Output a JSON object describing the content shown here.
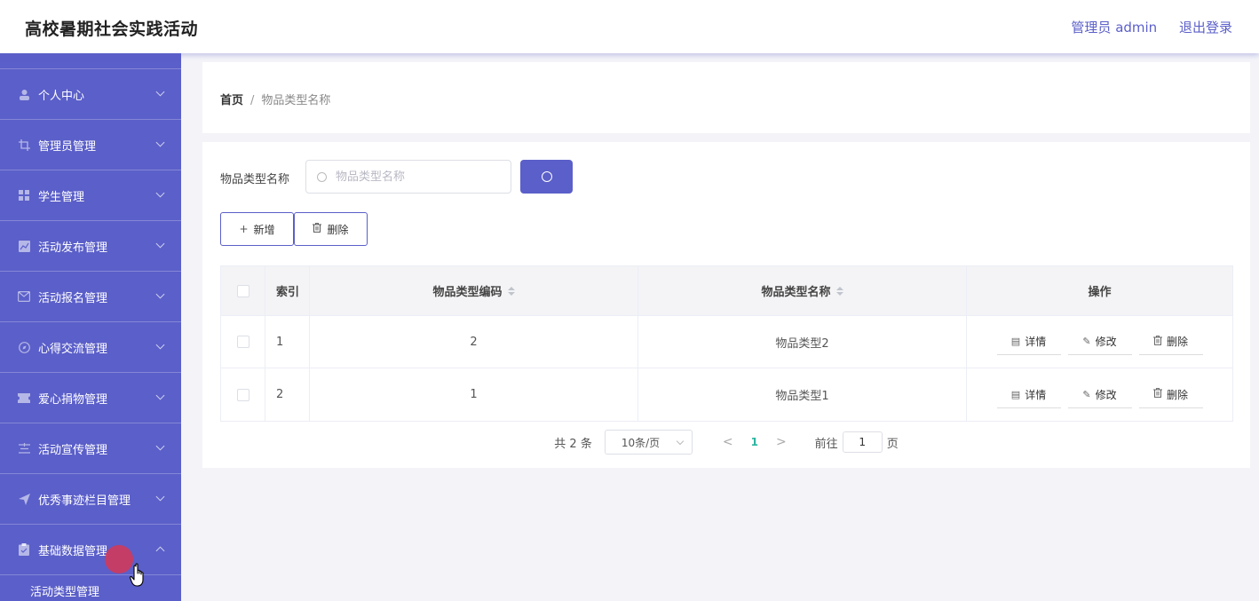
{
  "header": {
    "title": "高校暑期社会实践活动",
    "user": "管理员 admin",
    "logout": "退出登录"
  },
  "sidebar": {
    "items": [
      {
        "label": "个人中心",
        "icon": "user-icon"
      },
      {
        "label": "管理员管理",
        "icon": "crop-icon"
      },
      {
        "label": "学生管理",
        "icon": "grid-icon"
      },
      {
        "label": "活动发布管理",
        "icon": "chart-icon"
      },
      {
        "label": "活动报名管理",
        "icon": "mail-icon"
      },
      {
        "label": "心得交流管理",
        "icon": "compass-icon"
      },
      {
        "label": "爱心捐物管理",
        "icon": "ticket-icon"
      },
      {
        "label": "活动宣传管理",
        "icon": "list-icon"
      },
      {
        "label": "优秀事迹栏目管理",
        "icon": "send-icon"
      },
      {
        "label": "基础数据管理",
        "icon": "clipboard-icon"
      }
    ],
    "submenu": [
      "活动类型管理"
    ]
  },
  "breadcrumb": {
    "home": "首页",
    "separator": "/",
    "current": "物品类型名称"
  },
  "search": {
    "label": "物品类型名称",
    "placeholder": "物品类型名称"
  },
  "toolbar": {
    "add_label": "新增",
    "delete_label": "删除"
  },
  "table": {
    "headers": {
      "index": "索引",
      "code": "物品类型编码",
      "name": "物品类型名称",
      "ops": "操作"
    },
    "rows": [
      {
        "index": "1",
        "code": "2",
        "name": "物品类型2"
      },
      {
        "index": "2",
        "code": "1",
        "name": "物品类型1"
      }
    ],
    "ops": {
      "detail": "详情",
      "edit": "修改",
      "delete": "删除"
    }
  },
  "pagination": {
    "total": "共 2 条",
    "page_size": "10条/页",
    "prev": "<",
    "current": "1",
    "next": ">",
    "goto_label": "前往",
    "goto_value": "1",
    "page_suffix": "页"
  },
  "colors": {
    "accent": "#5b5fc9",
    "current_page": "#2bb5a0"
  }
}
